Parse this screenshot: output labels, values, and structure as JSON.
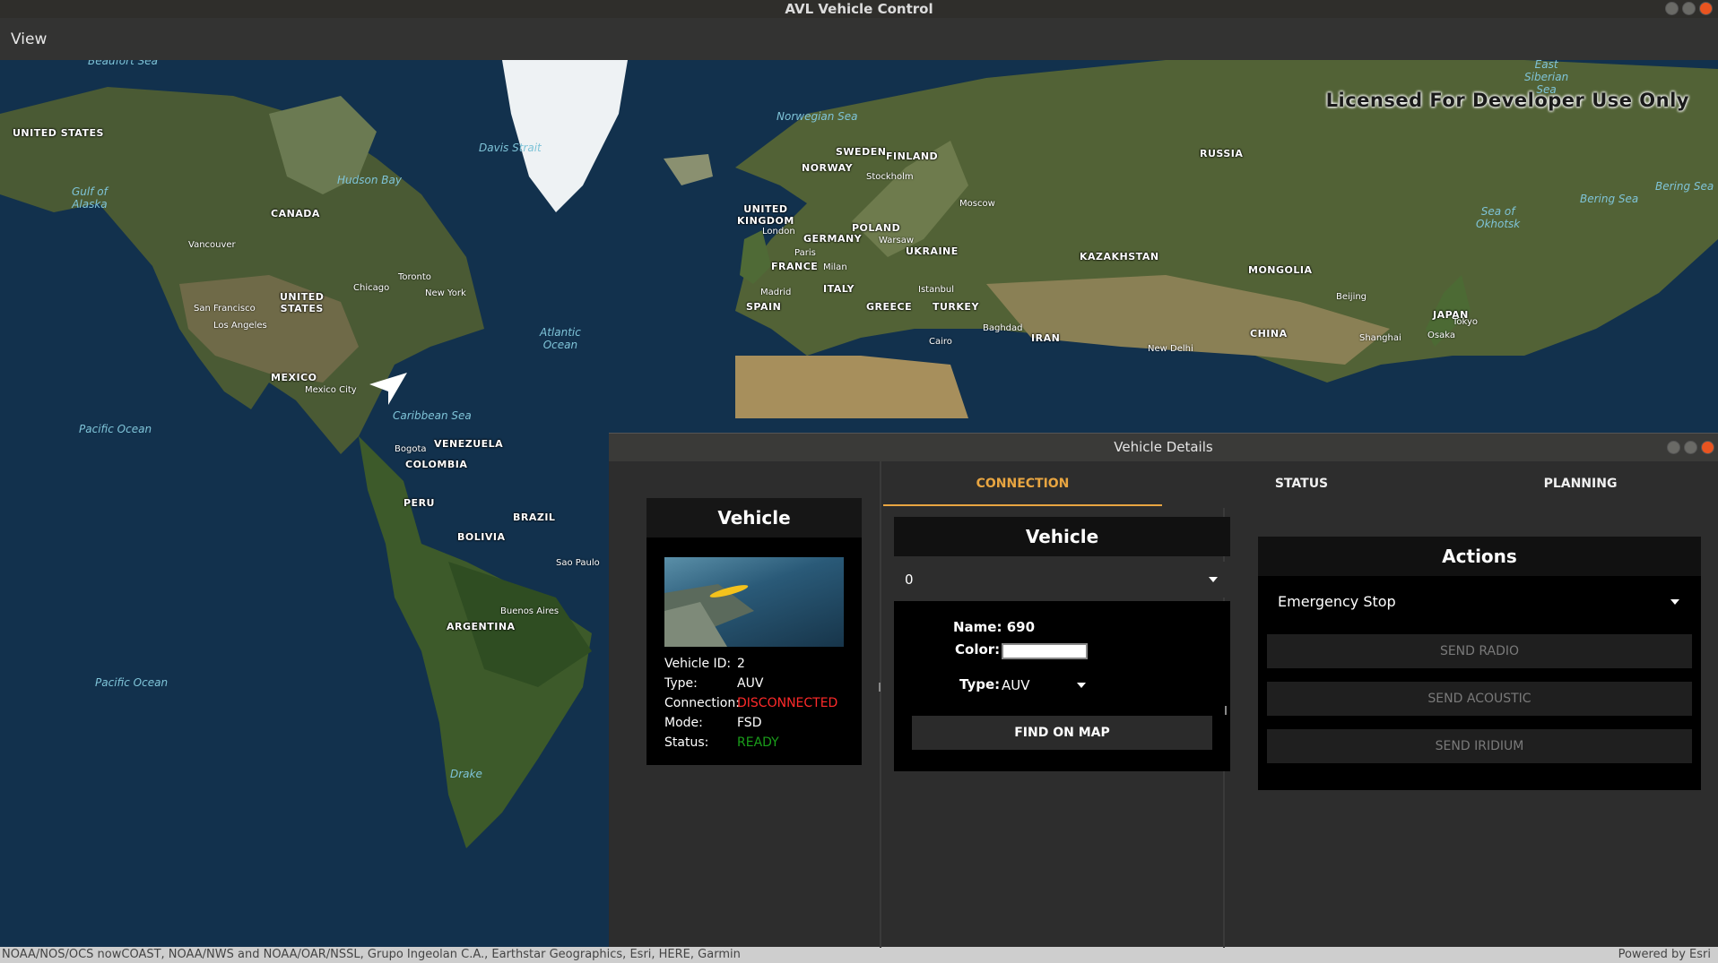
{
  "window": {
    "title": "AVL Vehicle Control"
  },
  "menu": {
    "view_label": "View"
  },
  "map": {
    "license_text": "Licensed For Developer Use Only",
    "countries": [
      {
        "name": "UNITED STATES"
      },
      {
        "name": "CANADA"
      },
      {
        "name": "UNITED\nSTATES"
      },
      {
        "name": "MEXICO"
      },
      {
        "name": "VENEZUELA"
      },
      {
        "name": "COLOMBIA"
      },
      {
        "name": "PERU"
      },
      {
        "name": "BRAZIL"
      },
      {
        "name": "BOLIVIA"
      },
      {
        "name": "ARGENTINA"
      },
      {
        "name": "SWEDEN"
      },
      {
        "name": "FINLAND"
      },
      {
        "name": "NORWAY"
      },
      {
        "name": "RUSSIA"
      },
      {
        "name": "UNITED\nKINGDOM"
      },
      {
        "name": "POLAND"
      },
      {
        "name": "GERMANY"
      },
      {
        "name": "UKRAINE"
      },
      {
        "name": "FRANCE"
      },
      {
        "name": "ITALY"
      },
      {
        "name": "SPAIN"
      },
      {
        "name": "GREECE"
      },
      {
        "name": "TURKEY"
      },
      {
        "name": "KAZAKHSTAN"
      },
      {
        "name": "MONGOLIA"
      },
      {
        "name": "IRAN"
      },
      {
        "name": "CHINA"
      },
      {
        "name": "JAPAN"
      }
    ],
    "cities": [
      "Vancouver",
      "Chicago",
      "Toronto",
      "New York",
      "San Francisco",
      "Los Angeles",
      "Mexico City",
      "Bogota",
      "Sao Paulo",
      "Buenos Aires",
      "Stockholm",
      "Moscow",
      "London",
      "Paris",
      "Warsaw",
      "Milan",
      "Madrid",
      "Istanbul",
      "Baghdad",
      "Cairo",
      "New Delhi",
      "Beijing",
      "Shanghai",
      "Tokyo",
      "Osaka"
    ],
    "oceans": [
      "Beaufort Sea",
      "Gulf of\nAlaska",
      "Hudson Bay",
      "Davis Strait",
      "Norwegian Sea",
      "Atlantic\nOcean",
      "Caribbean Sea",
      "Pacific Ocean",
      "Pacific Ocean",
      "Bering Sea",
      "Sea of\nOkhotsk",
      "East\nSiberian\nSea",
      "Bering Sea",
      "Drake"
    ]
  },
  "attribution": {
    "text": "NOAA/NOS/OCS nowCOAST, NOAA/NWS and NOAA/OAR/NSSL, Grupo Ingeolan C.A., Earthstar Geographics, Esri, HERE, Garmin",
    "powered": "Powered by Esri"
  },
  "details": {
    "title": "Vehicle Details",
    "vehicle_card": {
      "heading": "Vehicle",
      "rows": [
        {
          "key": "Vehicle ID:",
          "value": "2",
          "color": "#ffffff"
        },
        {
          "key": "Type:",
          "value": "AUV",
          "color": "#ffffff"
        },
        {
          "key": "Connection:",
          "value": "DISCONNECTED",
          "color": "#ff2a2a"
        },
        {
          "key": "Mode:",
          "value": "FSD",
          "color": "#ffffff"
        },
        {
          "key": "Status:",
          "value": "READY",
          "color": "#1a9e1a"
        }
      ]
    },
    "tabs": [
      {
        "label": "CONNECTION",
        "active": true
      },
      {
        "label": "STATUS",
        "active": false
      },
      {
        "label": "PLANNING",
        "active": false
      }
    ],
    "connection": {
      "heading": "Vehicle",
      "selected_vehicle": "0",
      "name_label": "Name:",
      "name_value": "690",
      "color_label": "Color:",
      "color_value": "#ffffff",
      "type_label": "Type:",
      "type_value": "AUV",
      "find_button": "FIND ON MAP"
    },
    "actions": {
      "heading": "Actions",
      "selected_action": "Emergency Stop",
      "buttons": [
        "SEND RADIO",
        "SEND ACOUSTIC",
        "SEND IRIDIUM"
      ]
    }
  },
  "colors": {
    "accent": "#e8a541",
    "disconnected": "#ff2a2a",
    "ready": "#1a9e1a"
  }
}
